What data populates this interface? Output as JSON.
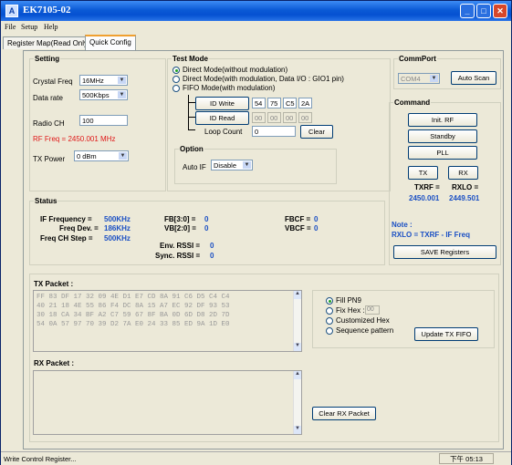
{
  "window": {
    "title": "EK7105-02",
    "icon_text": "A"
  },
  "menu": {
    "file": "File",
    "setup": "Setup",
    "help": "Help"
  },
  "tabs": [
    {
      "label": "Register Map(Read Only)"
    },
    {
      "label": "Quick Config"
    }
  ],
  "setting": {
    "legend": "Setting",
    "crystal_label": "Crystal Freq",
    "crystal_value": "16MHz",
    "datarate_label": "Data rate",
    "datarate_value": "500Kbps",
    "radioch_label": "Radio CH",
    "radioch_value": "100",
    "rf_freq_text": "RF Freq = 2450.001 MHz",
    "txpower_label": "TX Power",
    "txpower_value": "0 dBm"
  },
  "testmode": {
    "legend": "Test Mode",
    "radio1": "Direct Mode(without modulation)",
    "radio2": "Direct Mode(with modulation, Data I/O : GIO1 pin)",
    "radio3": "FIFO Mode(with modulation)",
    "id_write_label": "ID Write",
    "id_write_bytes": [
      "54",
      "75",
      "C5",
      "2A"
    ],
    "id_read_label": "ID Read",
    "id_read_bytes": [
      "00",
      "00",
      "00",
      "00"
    ],
    "loop_count_label": "Loop Count",
    "loop_count_value": "0",
    "clear_label": "Clear"
  },
  "option": {
    "legend": "Option",
    "autoif_label": "Auto IF",
    "autoif_value": "Disable"
  },
  "commport": {
    "legend": "CommPort",
    "port_value": "COM4",
    "autoscan_label": "Auto Scan"
  },
  "command": {
    "legend": "Command",
    "init_rf": "Init. RF",
    "standby": "Standby",
    "pll": "PLL",
    "tx": "TX",
    "rx": "RX",
    "txrf_label": "TXRF =",
    "rxlo_label": "RXLO =",
    "txrf_value": "2450.001",
    "rxlo_value": "2449.501"
  },
  "note": {
    "line1": "Note :",
    "line2": "RXLO = TXRF - IF Freq"
  },
  "save_registers": "SAVE Registers",
  "status": {
    "legend": "Status",
    "if_freq_label": "IF Frequency =",
    "if_freq_value": "500KHz",
    "freq_dev_label": "Freq Dev. =",
    "freq_dev_value": "186KHz",
    "freq_ch_step_label": "Freq CH Step =",
    "freq_ch_step_value": "500KHz",
    "fb_label": "FB[3:0] =",
    "fb_value": "0",
    "vb_label": "VB[2:0] =",
    "vb_value": "0",
    "fbcf_label": "FBCF =",
    "fbcf_value": "0",
    "vbcf_label": "VBCF =",
    "vbcf_value": "0",
    "env_rssi_label": "Env. RSSI =",
    "env_rssi_value": "0",
    "sync_rssi_label": "Sync. RSSI =",
    "sync_rssi_value": "0"
  },
  "tx_packet": {
    "label": "TX Packet :",
    "lines": [
      "FF 83 DF 17 32 09 4E D1 E7 CD 8A 91 C6 D5 C4 C4",
      "40 21 18 4E 55 86 F4 DC 8A 15 A7 EC 92 DF 93 53",
      "30 18 CA 34 BF A2 C7 59 67 8F BA 0D 6D D8 2D 7D",
      "54 0A 57 97 70 39 D2 7A E0 24 33 85 ED 9A 1D E0"
    ],
    "fill_pn9": "Fill PN9",
    "fix_hex": "Fix Hex :",
    "fix_hex_value": "00",
    "customized_hex": "Customized Hex",
    "sequence_pattern": "Sequence pattern",
    "update_label": "Update TX FIFO"
  },
  "rx_packet": {
    "label": "RX Packet :",
    "clear_label": "Clear RX Packet"
  },
  "statusbar": {
    "text": "Write Control Register...",
    "clock": "下午 05:13"
  }
}
